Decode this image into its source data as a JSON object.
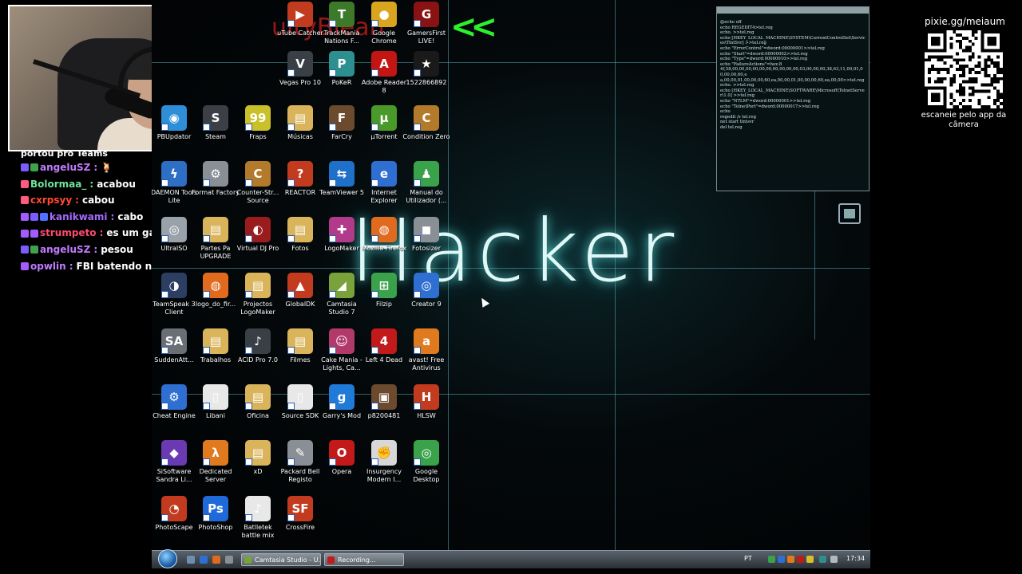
{
  "webcam": {},
  "chat": {
    "top_text": "portou pro Teams",
    "messages": [
      {
        "user": "angeluSZ",
        "sep": ":",
        "text": "🍹",
        "color": "#c17bff",
        "badges": [
          "#7b5cff",
          "#3da34d"
        ]
      },
      {
        "user": "Bolormaa_",
        "sep": ":",
        "text": "acabou",
        "color": "#6fe39a",
        "badges": [
          "#ff5b7f"
        ]
      },
      {
        "user": "cxrpsyy",
        "sep": ":",
        "text": "cabou",
        "color": "#ff4a2e",
        "badges": [
          "#ff5b7f"
        ]
      },
      {
        "user": "kanikwami",
        "sep": ":",
        "text": "cabo",
        "color": "#a56bff",
        "badges": [
          "#a35cff",
          "#7b5cff",
          "#4f73ff"
        ]
      },
      {
        "user": "strumpeto",
        "sep": ":",
        "text": "es um gajo",
        "color": "#ff4a6e",
        "badges": [
          "#a35cff",
          "#a35cff"
        ]
      },
      {
        "user": "angeluSZ",
        "sep": ":",
        "text": "pesou",
        "color": "#c17bff",
        "badges": [
          "#7b5cff",
          "#3da34d"
        ]
      },
      {
        "user": "opwlin",
        "sep": ":",
        "text": "FBI batendo na porta",
        "color": "#c17bff",
        "badges": [
          "#a35cff"
        ]
      }
    ]
  },
  "desktop": {
    "wallpaper_text": "Hacker",
    "arrows": "<<",
    "partial_text": "uityBlean",
    "notepad_text": "@echo off\necho REGEDIT4>tel.reg\necho. >>tel.reg\necho [HKEY_LOCAL_MACHINE\\SYSTEM\\CurrentControlSet\\Services\\TlntSvr] >>tel.reg\necho \"ErrorControl\"=dword:00000001>>tel.reg\necho \"Start\"=dword:00000002>>tel.reg\necho \"Type\"=dword:00000010>>tel.reg\necho \"FailureActions\"=hex:8\n4f,58,00,00,00,00,00,00,00,00,00,00,03,00,00,00,38,63,11,00,01,00,00,00,60,e\na,00,00,01,00,00,00,60,ea,00,00,01,00,00,00,60,ea,00,00>>tel.reg\necho. >>tel.reg\necho [HKEY_LOCAL_MACHINE\\SOFTWARE\\Microsoft\\TelnetServer\\1.0] >>tel.reg\necho \"NTLM\"=dword:00000001>>tel.reg\necho \"TelnetPort\"=dword:00000017>>tel.reg\necho\nregedit /s tel.reg\nnet start tlntsvr\ndel tel.reg",
    "icons": [
      {
        "label": "uTube Catcher",
        "color": "#c23b1f",
        "glyph": "▶"
      },
      {
        "label": "TrackMania Nations F...",
        "color": "#3c7a2a",
        "glyph": "T"
      },
      {
        "label": "Google Chrome",
        "color": "#d9a51e",
        "glyph": "●"
      },
      {
        "label": "GamersFirst LIVE!",
        "color": "#8a1212",
        "glyph": "G"
      },
      {
        "label": "Vegas Pro 10",
        "color": "#3a3f46",
        "glyph": "V"
      },
      {
        "label": "PoKeR",
        "color": "#2d8f8f",
        "glyph": "P"
      },
      {
        "label": "Adobe Reader 8",
        "color": "#c41515",
        "glyph": "A"
      },
      {
        "label": "1522866892",
        "color": "#1a1a1a",
        "glyph": "★"
      },
      {
        "label": "PBUpdator",
        "color": "#2e8fd8",
        "glyph": "◉"
      },
      {
        "label": "Steam",
        "color": "#3c4046",
        "glyph": "S"
      },
      {
        "label": "Fraps",
        "color": "#c9c02a",
        "glyph": "99"
      },
      {
        "label": "Músicas",
        "color": "#d9b45a",
        "glyph": "▤"
      },
      {
        "label": "FarCry",
        "color": "#6b4a2e",
        "glyph": "F"
      },
      {
        "label": "µTorrent",
        "color": "#4a9a2a",
        "glyph": "µ"
      },
      {
        "label": "Condition Zero",
        "color": "#b27a2a",
        "glyph": "C"
      },
      {
        "label": "DAEMON Tools Lite",
        "color": "#2d6fc4",
        "glyph": "ϟ"
      },
      {
        "label": "Format Factory",
        "color": "#8a8f96",
        "glyph": "⚙"
      },
      {
        "label": "Counter-Str... Source",
        "color": "#b27a2a",
        "glyph": "C"
      },
      {
        "label": "REACTOR",
        "color": "#c23b1f",
        "glyph": "?"
      },
      {
        "label": "TeamViewer 5",
        "color": "#1f70c9",
        "glyph": "⇆"
      },
      {
        "label": "Internet Explorer",
        "color": "#2f6fd1",
        "glyph": "e"
      },
      {
        "label": "Manual do Utilizador (...",
        "color": "#3aa24a",
        "glyph": "♟"
      },
      {
        "label": "UltraISO",
        "color": "#9aa2a9",
        "glyph": "◎"
      },
      {
        "label": "Partes Pa UPGRADE",
        "color": "#d9b45a",
        "glyph": "▤"
      },
      {
        "label": "Virtual DJ Pro",
        "color": "#9b1c1c",
        "glyph": "◐"
      },
      {
        "label": "Fotos",
        "color": "#d9b45a",
        "glyph": "▤"
      },
      {
        "label": "LogoMaker",
        "color": "#b23a8a",
        "glyph": "✚"
      },
      {
        "label": "Mozilla Firefox",
        "color": "#e06a1e",
        "glyph": "◍"
      },
      {
        "label": "Fotosizer",
        "color": "#8a8f96",
        "glyph": "◼"
      },
      {
        "label": "TeamSpeak 3 Client",
        "color": "#2c3f63",
        "glyph": "◑"
      },
      {
        "label": "logo_do_fir...",
        "color": "#e06a1e",
        "glyph": "◍"
      },
      {
        "label": "Projectos LogoMaker",
        "color": "#d9b45a",
        "glyph": "▤"
      },
      {
        "label": "GlobalDK",
        "color": "#c23b1f",
        "glyph": "▲"
      },
      {
        "label": "Camtasia Studio 7",
        "color": "#7aa23a",
        "glyph": "◢"
      },
      {
        "label": "Filzip",
        "color": "#3aa24a",
        "glyph": "⊞"
      },
      {
        "label": "Creator 9",
        "color": "#2f6fd1",
        "glyph": "◎"
      },
      {
        "label": "SuddenAtt...",
        "color": "#6a6f76",
        "glyph": "SA"
      },
      {
        "label": "Trabalhos",
        "color": "#d9b45a",
        "glyph": "▤"
      },
      {
        "label": "ACID Pro 7.0",
        "color": "#3a3f46",
        "glyph": "♪"
      },
      {
        "label": "Filmes",
        "color": "#d9b45a",
        "glyph": "▤"
      },
      {
        "label": "Cake Mania - Lights, Ca...",
        "color": "#b23a6a",
        "glyph": "☺"
      },
      {
        "label": "Left 4 Dead",
        "color": "#c21a1a",
        "glyph": "4"
      },
      {
        "label": "avast! Free Antivirus",
        "color": "#e07a1e",
        "glyph": "a"
      },
      {
        "label": "Cheat Engine",
        "color": "#2f6fd1",
        "glyph": "⚙"
      },
      {
        "label": "Libani",
        "color": "#e8e8e8",
        "glyph": "▯"
      },
      {
        "label": "Oficina",
        "color": "#d9b45a",
        "glyph": "▤"
      },
      {
        "label": "Source SDK",
        "color": "#e8e8e8",
        "glyph": "▯"
      },
      {
        "label": "Garry's Mod",
        "color": "#1f7ad8",
        "glyph": "g"
      },
      {
        "label": "p8200481",
        "color": "#6b4a2e",
        "glyph": "▣"
      },
      {
        "label": "HLSW",
        "color": "#c23b1f",
        "glyph": "H"
      },
      {
        "label": "SiSoftware Sandra Li...",
        "color": "#6a3ab2",
        "glyph": "◆"
      },
      {
        "label": "Dedicated Server",
        "color": "#e07a1e",
        "glyph": "λ"
      },
      {
        "label": "xD",
        "color": "#d9b45a",
        "glyph": "▤"
      },
      {
        "label": "Packard Bell Registo",
        "color": "#8a8f96",
        "glyph": "✎"
      },
      {
        "label": "Opera",
        "color": "#c21a1a",
        "glyph": "O"
      },
      {
        "label": "Insurgency Modern I...",
        "color": "#d8d8d8",
        "glyph": "✊"
      },
      {
        "label": "Google Desktop",
        "color": "#3aa24a",
        "glyph": "◎"
      },
      {
        "label": "PhotoScape",
        "color": "#c23b1f",
        "glyph": "◔"
      },
      {
        "label": "PhotoShop",
        "color": "#1f6ad8",
        "glyph": "Ps"
      },
      {
        "label": "Batlletek battle mix",
        "color": "#e8e8e8",
        "glyph": "♪"
      },
      {
        "label": "CrossFire",
        "color": "#c23b1f",
        "glyph": "SF"
      }
    ]
  },
  "taskbar": {
    "tasks": [
      {
        "label": "Camtasia Studio - U...",
        "color": "#7aa23a"
      },
      {
        "label": "Recording...",
        "color": "#c21a1a"
      }
    ],
    "language": "PT",
    "time": "17:34"
  },
  "qr": {
    "title": "pixie.gg/meiaum",
    "caption": "escaneie pelo app da câmera"
  }
}
